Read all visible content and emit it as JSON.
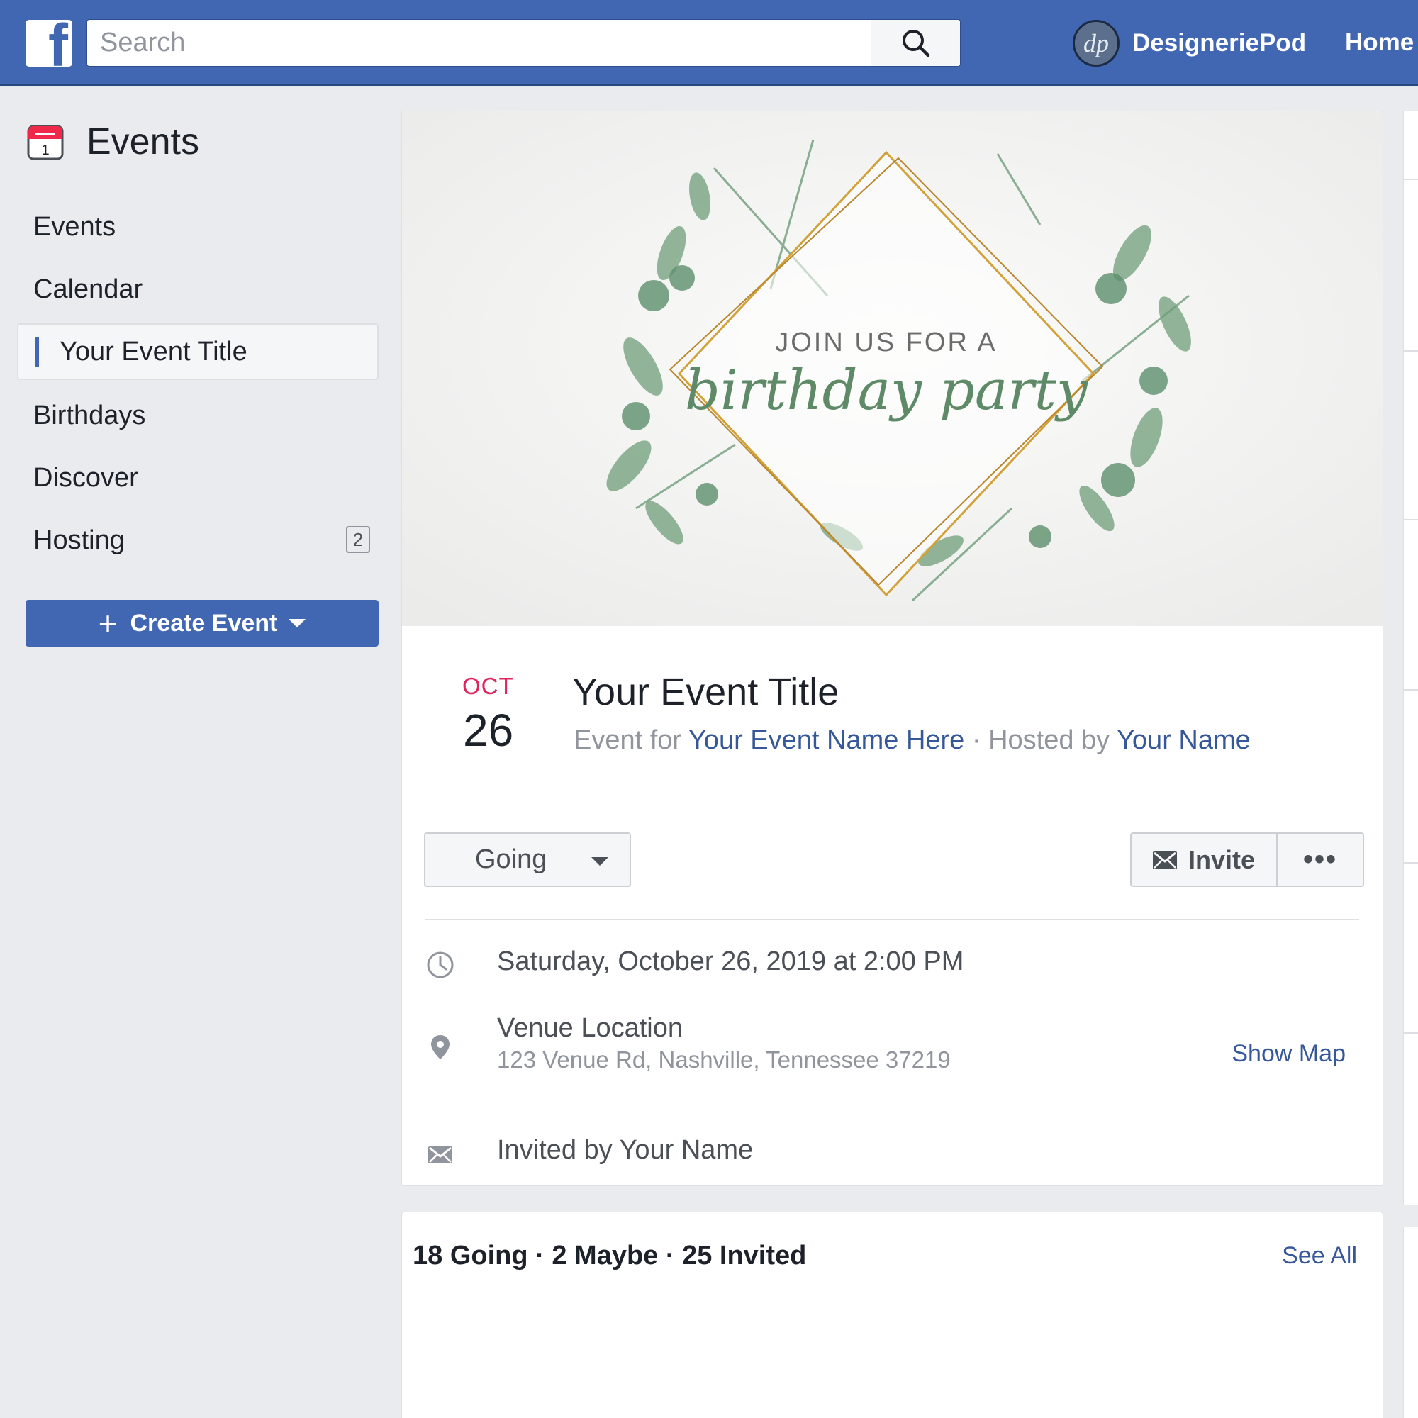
{
  "header": {
    "search_placeholder": "Search",
    "profile_initials": "dp",
    "profile_name": "DesigneriePod",
    "home_label": "Home"
  },
  "sidebar": {
    "title": "Events",
    "calendar_icon_day": "1",
    "items": [
      {
        "label": "Events"
      },
      {
        "label": "Calendar"
      },
      {
        "label": "Your Event Title",
        "active": true
      },
      {
        "label": "Birthdays"
      },
      {
        "label": "Discover"
      },
      {
        "label": "Hosting",
        "count": "2"
      }
    ],
    "create_label": "Create Event"
  },
  "cover": {
    "line1": "JOIN US FOR A",
    "line2": "birthday party"
  },
  "event": {
    "month": "OCT",
    "day": "26",
    "title": "Your Event Title",
    "event_for_prefix": "Event for",
    "event_for_name": "Your Event Name Here",
    "separator": "·",
    "hosted_by_prefix": "Hosted by",
    "host_name": "Your Name"
  },
  "actions": {
    "going_label": "Going",
    "invite_label": "Invite",
    "more_label": "•••"
  },
  "details": {
    "when": "Saturday, October 26, 2019 at 2:00 PM",
    "venue_name": "Venue Location",
    "venue_address": "123 Venue Rd, Nashville, Tennessee 37219",
    "show_map_label": "Show Map",
    "invited_by": "Invited by Your Name"
  },
  "guests": {
    "summary": "18 Going · 2 Maybe · 25 Invited",
    "see_all_label": "See All"
  },
  "colors": {
    "brand": "#4267b2",
    "link": "#365899",
    "month_red": "#e0245e",
    "gold_frame": "#d1a23a",
    "foliage": "#6e9c78"
  }
}
